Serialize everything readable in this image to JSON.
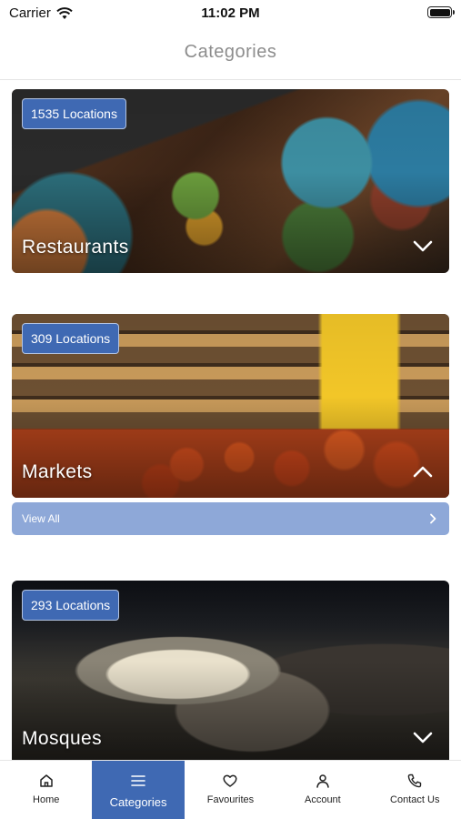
{
  "status_bar": {
    "carrier": "Carrier",
    "time": "11:02 PM"
  },
  "header": {
    "title": "Categories"
  },
  "categories": [
    {
      "title": "Restaurants",
      "badge": "1535 Locations",
      "chevron": "chevron-down-icon"
    },
    {
      "title": "Markets",
      "badge": "309 Locations",
      "chevron": "chevron-up-icon"
    },
    {
      "title": "Mosques",
      "badge": "293 Locations",
      "chevron": "chevron-down-icon"
    }
  ],
  "view_all": {
    "label": "View All"
  },
  "tabs": [
    {
      "label": "Home",
      "icon": "home-icon"
    },
    {
      "label": "Categories",
      "icon": "menu-icon"
    },
    {
      "label": "Favourites",
      "icon": "heart-icon"
    },
    {
      "label": "Account",
      "icon": "user-icon"
    },
    {
      "label": "Contact Us",
      "icon": "phone-icon"
    }
  ],
  "colors": {
    "accent": "#3f69b3",
    "view_all_bg": "#8ea8d8",
    "title_gray": "#8d8d8d"
  }
}
